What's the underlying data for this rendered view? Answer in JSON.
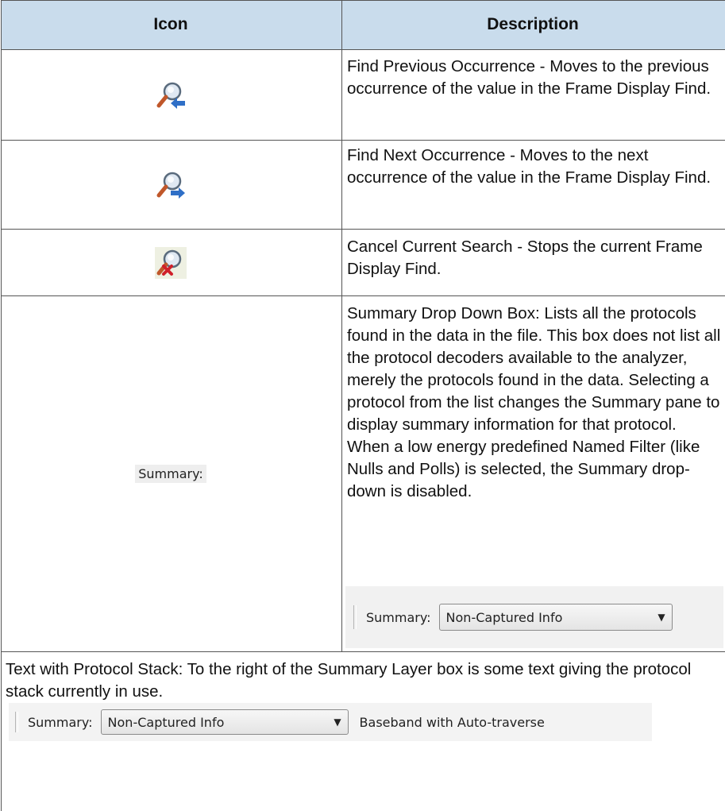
{
  "header": {
    "icon_col": "Icon",
    "description_col": "Description"
  },
  "rows": [
    {
      "icon": "find-previous-icon",
      "description": "Find Previous Occurrence - Moves to the previous occurrence of the value in the Frame Display Find."
    },
    {
      "icon": "find-next-icon",
      "description": "Find Next Occurrence - Moves to the next occurrence of the value in the Frame Display Find."
    },
    {
      "icon": "cancel-search-icon",
      "description": "Cancel Current Search - Stops the current Frame Display Find."
    },
    {
      "icon_text": "Summary:",
      "description": "Summary Drop Down Box: Lists all the protocols found in the data in the file. This box does not list all the protocol decoders available to the analyzer, merely the protocols found in the data. Selecting a protocol from the list changes the Summary pane to display summary information for that protocol.  When a low energy predefined Named Filter (like Nulls and Polls) is selected, the Summary drop-down is disabled.",
      "screenshot": {
        "label": "Summary:",
        "value": "Non-Captured Info"
      }
    }
  ],
  "full_row": {
    "text": "Text with Protocol Stack: To the right of the Summary Layer box is some text giving the protocol stack currently in use.",
    "screenshot": {
      "label": "Summary:",
      "value": "Non-Captured Info",
      "stack": "Baseband with Auto-traverse"
    }
  }
}
